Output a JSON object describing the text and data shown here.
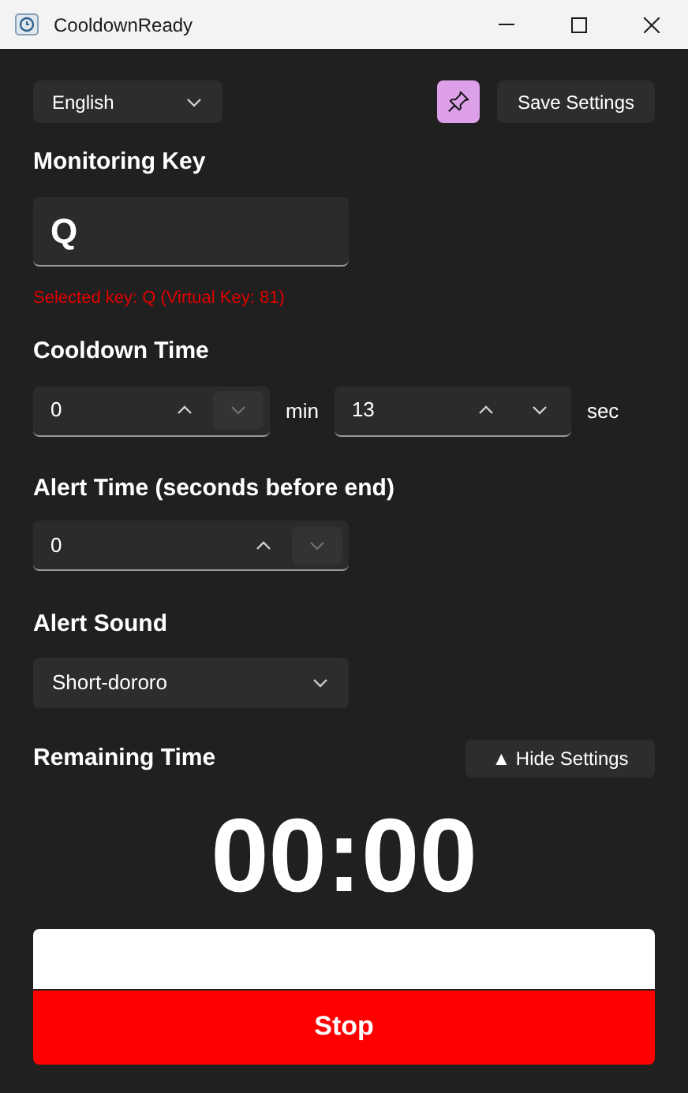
{
  "window": {
    "title": "CooldownReady"
  },
  "language": {
    "value": "English"
  },
  "pin_button": {
    "on": true
  },
  "save_button": "Save Settings",
  "monitoring_key": {
    "label": "Monitoring Key",
    "value": "Q",
    "status": "Selected key: Q (Virtual Key: 81)"
  },
  "cooldown": {
    "label": "Cooldown Time",
    "spinners": [
      {
        "value": "0",
        "unit": "min",
        "down_disabled": true
      },
      {
        "value": "13",
        "unit": "sec",
        "down_disabled": false
      }
    ]
  },
  "alert_time": {
    "label": "Alert Time (seconds before end)",
    "spinner": {
      "value": "0",
      "down_disabled": true
    }
  },
  "alert_sound": {
    "label": "Alert Sound",
    "value": "Short-dororo"
  },
  "remaining": {
    "label": "Remaining Time",
    "toggle": "▲ Hide Settings",
    "time": "00:00",
    "progress": {
      "level": 1
    }
  },
  "stop_button": "Stop"
}
